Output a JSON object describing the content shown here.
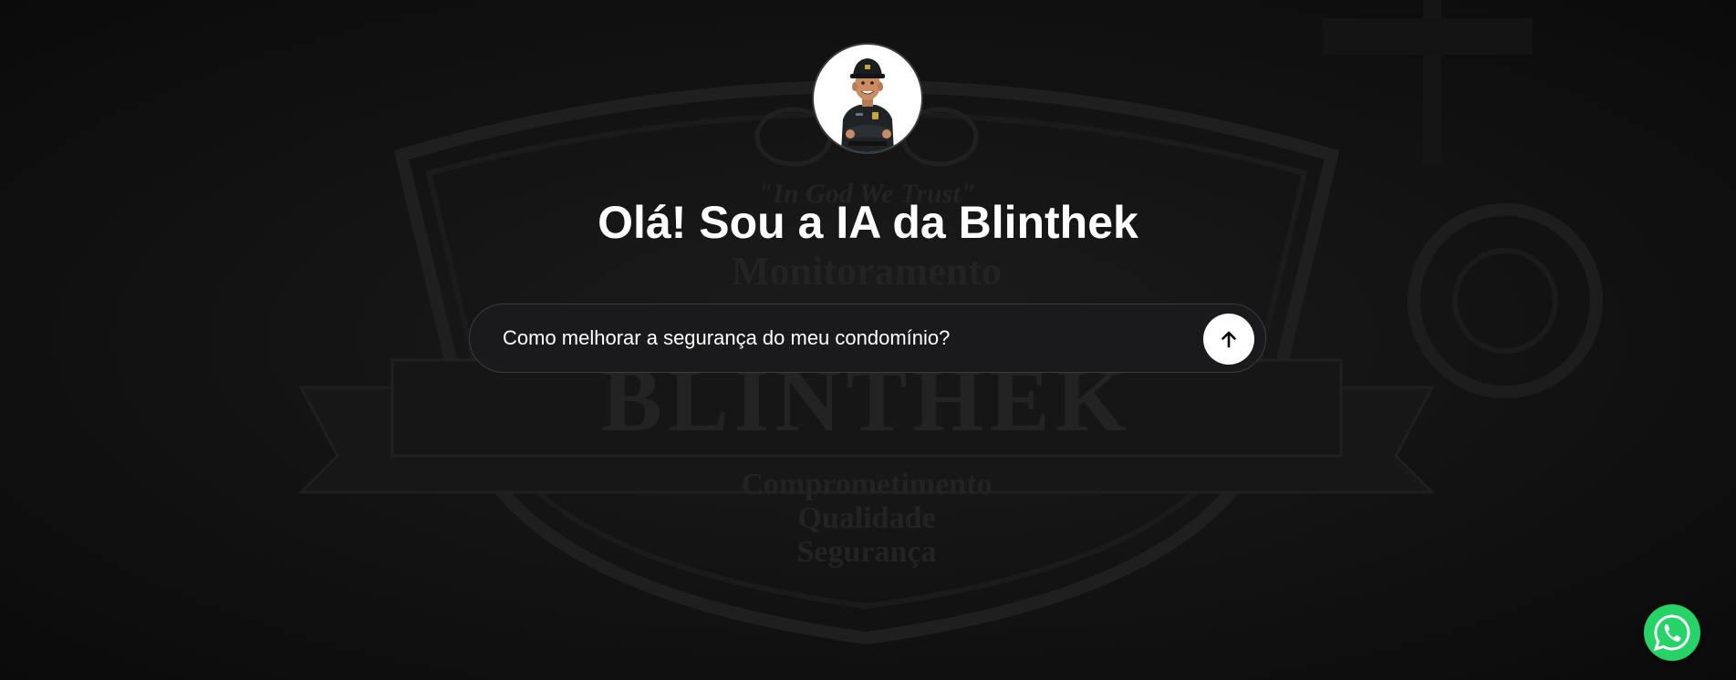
{
  "header": {
    "title": "Olá! Sou a IA da Blinthek"
  },
  "background": {
    "motto": "\"In God We Trust\"",
    "subtitle": "Monitoramento",
    "brand": "BLINTHEK",
    "values": [
      "Comprometimento",
      "Qualidade",
      "Segurança"
    ]
  },
  "prompt": {
    "placeholder": "Como melhorar a segurança do meu condomínio?"
  },
  "icons": {
    "avatar": "security-guard-avatar",
    "send": "arrow-up-icon",
    "whatsapp": "whatsapp-icon"
  },
  "colors": {
    "whatsapp": "#25d366",
    "background": "#0d0d0d",
    "text": "#ffffff"
  }
}
